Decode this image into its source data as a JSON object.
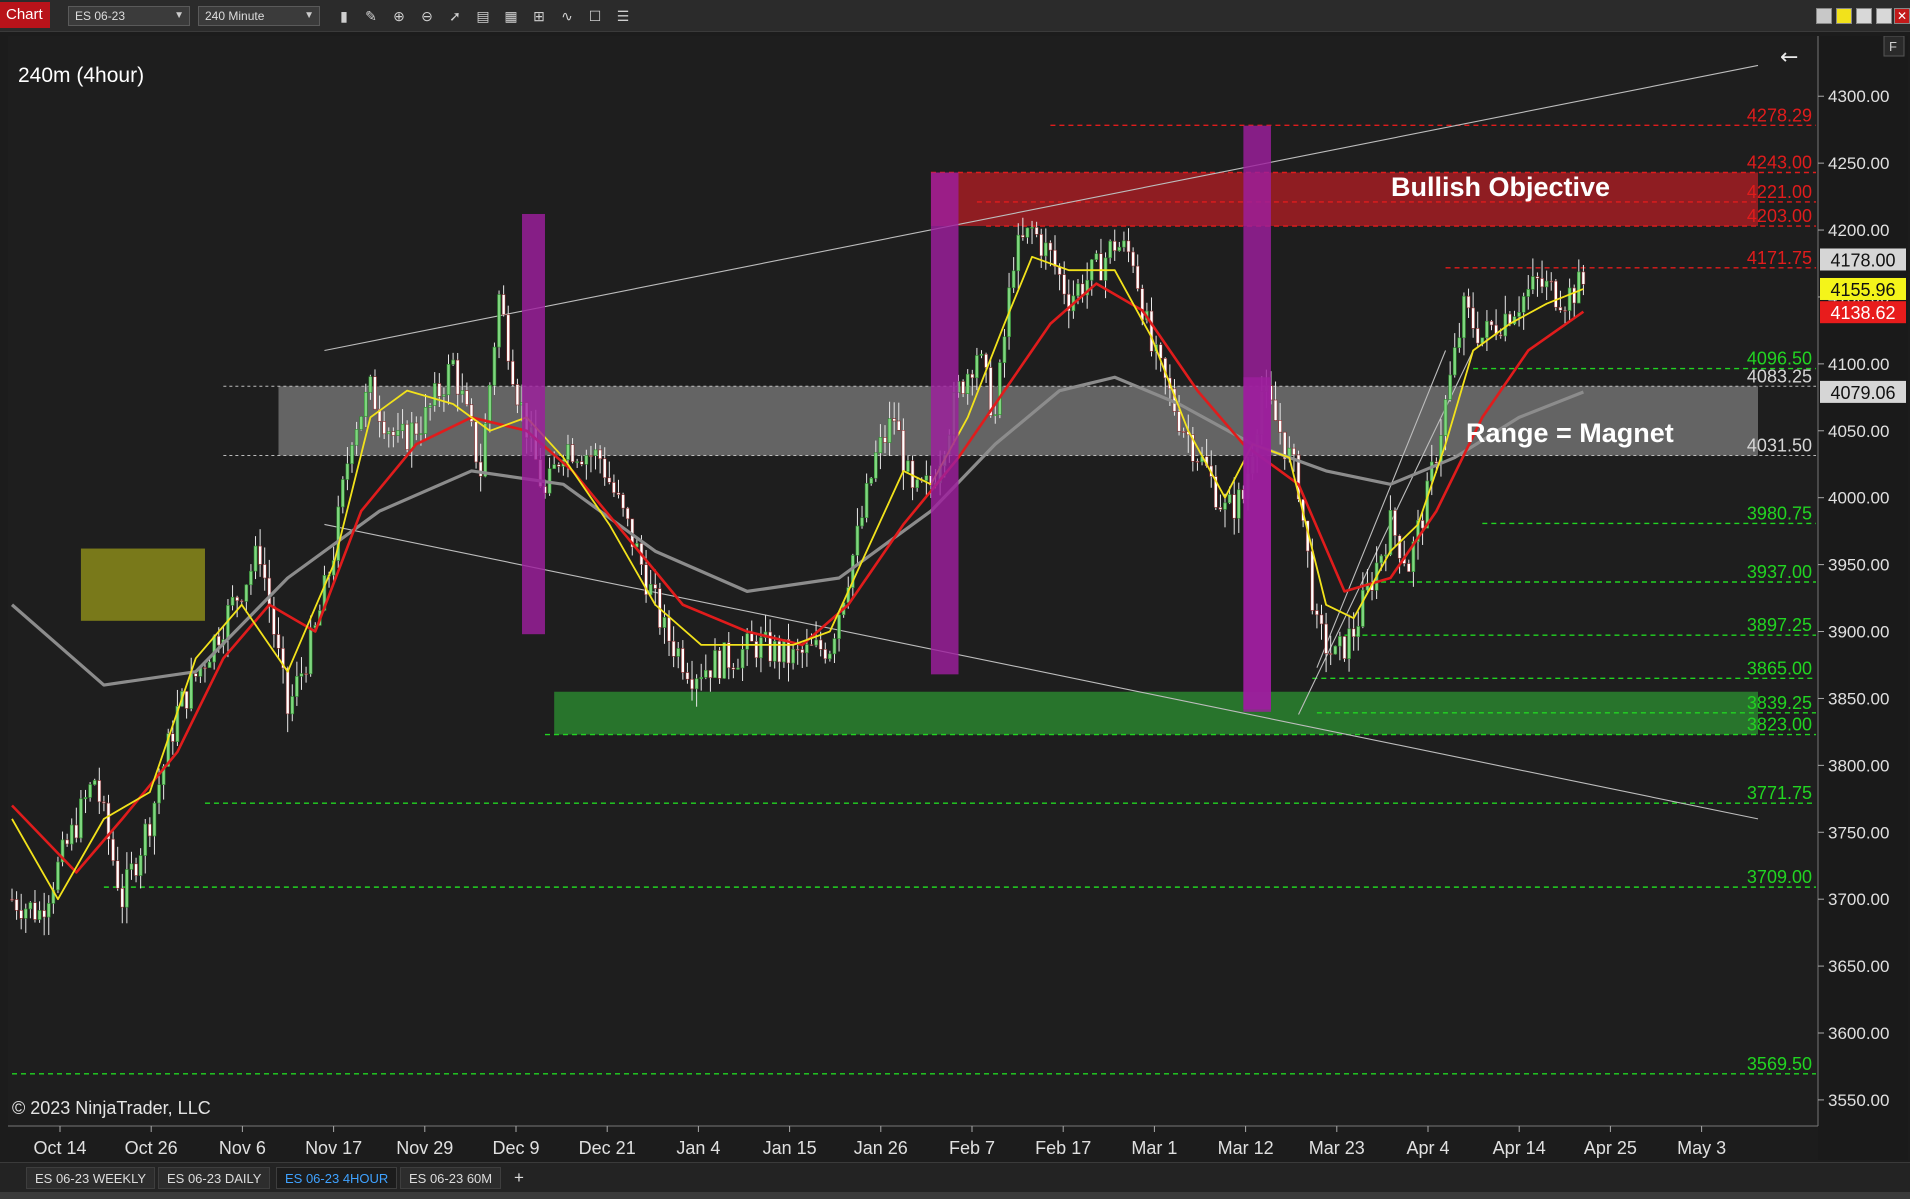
{
  "window": {
    "app_label": "Chart",
    "instrument": "ES 06-23",
    "timeframe": "240 Minute",
    "f_button": "F"
  },
  "chart": {
    "panel_label": "240m (4hour)",
    "copyright": "© 2023 NinjaTrader, LLC",
    "back_arrow": "←",
    "annotations": {
      "bullish_objective": "Bullish Objective",
      "range_magnet": "Range = Magnet"
    },
    "colors": {
      "background": "#1e1e1e",
      "fast_ma": "#f2e21b",
      "slow_ma": "#e01c1c",
      "long_ma": "#8c8c8c",
      "support_level": "#22d422",
      "resistance_level": "#e01c1c",
      "supply_zone": "#b51e24",
      "demand_zone": "#2b8a2f",
      "range_zone": "#8a8a8a",
      "highlight_bar": "#9d1f9d",
      "yellow_box": "#8a8a1a"
    }
  },
  "chart_data": {
    "type": "candlestick",
    "y_axis_ticks": [
      "4300.00",
      "4250.00",
      "4200.00",
      "4150.00",
      "4100.00",
      "4050.00",
      "4000.00",
      "3950.00",
      "3900.00",
      "3850.00",
      "3800.00",
      "3750.00",
      "3700.00",
      "3650.00",
      "3600.00",
      "3550.00"
    ],
    "ylim": [
      3532,
      4345
    ],
    "x_axis_ticks": [
      "Oct 14",
      "Oct 26",
      "Nov 6",
      "Nov 17",
      "Nov 29",
      "Dec 9",
      "Dec 21",
      "Jan 4",
      "Jan 15",
      "Jan 26",
      "Feb 7",
      "Feb 17",
      "Mar 1",
      "Mar 12",
      "Mar 23",
      "Apr 4",
      "Apr 14",
      "Apr 25",
      "May 3"
    ],
    "price_markers": [
      {
        "label": "4178.00",
        "value": 4178.0,
        "style": "gray"
      },
      {
        "label": "4155.96",
        "value": 4155.96,
        "style": "yellow"
      },
      {
        "label": "4138.62",
        "value": 4138.62,
        "style": "red"
      },
      {
        "label": "4079.06",
        "value": 4079.06,
        "style": "gray"
      }
    ],
    "resistance_levels": [
      {
        "label": "4278.29",
        "value": 4278.29
      },
      {
        "label": "4243.00",
        "value": 4243.0
      },
      {
        "label": "4221.00",
        "value": 4221.0
      },
      {
        "label": "4203.00",
        "value": 4203.0
      },
      {
        "label": "4171.75",
        "value": 4171.75
      }
    ],
    "support_levels": [
      {
        "label": "4096.50",
        "value": 4096.5
      },
      {
        "label": "3980.75",
        "value": 3980.75
      },
      {
        "label": "3937.00",
        "value": 3937.0
      },
      {
        "label": "3897.25",
        "value": 3897.25
      },
      {
        "label": "3865.00",
        "value": 3865.0
      },
      {
        "label": "3839.25",
        "value": 3839.25
      },
      {
        "label": "3823.00",
        "value": 3823.0
      },
      {
        "label": "3771.75",
        "value": 3771.75
      },
      {
        "label": "3709.00",
        "value": 3709.0
      },
      {
        "label": "3569.50",
        "value": 3569.5
      }
    ],
    "range_levels": [
      {
        "label": "4083.25",
        "value": 4083.25
      },
      {
        "label": "4031.50",
        "value": 4031.5
      }
    ],
    "close_path": [
      [
        0,
        3700
      ],
      [
        6,
        3690
      ],
      [
        12,
        3740
      ],
      [
        18,
        3790
      ],
      [
        24,
        3700
      ],
      [
        30,
        3760
      ],
      [
        36,
        3840
      ],
      [
        42,
        3880
      ],
      [
        48,
        3920
      ],
      [
        54,
        3960
      ],
      [
        60,
        3840
      ],
      [
        66,
        3900
      ],
      [
        70,
        3960
      ],
      [
        74,
        4050
      ],
      [
        78,
        4080
      ],
      [
        84,
        4040
      ],
      [
        90,
        4060
      ],
      [
        96,
        4100
      ],
      [
        102,
        4020
      ],
      [
        106,
        4150
      ],
      [
        110,
        4080
      ],
      [
        116,
        4000
      ],
      [
        120,
        4040
      ],
      [
        128,
        4030
      ],
      [
        136,
        3960
      ],
      [
        142,
        3900
      ],
      [
        148,
        3870
      ],
      [
        156,
        3880
      ],
      [
        162,
        3890
      ],
      [
        170,
        3880
      ],
      [
        178,
        3890
      ],
      [
        184,
        3970
      ],
      [
        188,
        4030
      ],
      [
        192,
        4060
      ],
      [
        196,
        4000
      ],
      [
        200,
        4010
      ],
      [
        206,
        4080
      ],
      [
        210,
        4110
      ],
      [
        214,
        4060
      ],
      [
        218,
        4180
      ],
      [
        222,
        4200
      ],
      [
        226,
        4180
      ],
      [
        230,
        4150
      ],
      [
        236,
        4170
      ],
      [
        240,
        4190
      ],
      [
        244,
        4180
      ],
      [
        248,
        4110
      ],
      [
        254,
        4060
      ],
      [
        260,
        4020
      ],
      [
        264,
        3990
      ],
      [
        268,
        4000
      ],
      [
        272,
        4080
      ],
      [
        276,
        4050
      ],
      [
        280,
        4010
      ],
      [
        284,
        3900
      ],
      [
        288,
        3880
      ],
      [
        292,
        3900
      ],
      [
        296,
        3940
      ],
      [
        300,
        3980
      ],
      [
        304,
        3950
      ],
      [
        308,
        4000
      ],
      [
        312,
        4070
      ],
      [
        316,
        4140
      ],
      [
        320,
        4120
      ],
      [
        326,
        4140
      ],
      [
        332,
        4160
      ],
      [
        338,
        4150
      ],
      [
        342,
        4160
      ]
    ],
    "fast_ma_path": [
      [
        0,
        3760
      ],
      [
        10,
        3700
      ],
      [
        20,
        3760
      ],
      [
        30,
        3780
      ],
      [
        40,
        3880
      ],
      [
        50,
        3920
      ],
      [
        60,
        3870
      ],
      [
        70,
        3950
      ],
      [
        78,
        4060
      ],
      [
        86,
        4080
      ],
      [
        96,
        4070
      ],
      [
        104,
        4050
      ],
      [
        112,
        4060
      ],
      [
        120,
        4030
      ],
      [
        130,
        3980
      ],
      [
        140,
        3920
      ],
      [
        150,
        3890
      ],
      [
        160,
        3890
      ],
      [
        170,
        3890
      ],
      [
        178,
        3900
      ],
      [
        186,
        3960
      ],
      [
        194,
        4020
      ],
      [
        200,
        4010
      ],
      [
        208,
        4060
      ],
      [
        216,
        4130
      ],
      [
        222,
        4180
      ],
      [
        230,
        4170
      ],
      [
        240,
        4170
      ],
      [
        248,
        4120
      ],
      [
        256,
        4050
      ],
      [
        264,
        4000
      ],
      [
        270,
        4040
      ],
      [
        278,
        4030
      ],
      [
        286,
        3920
      ],
      [
        292,
        3910
      ],
      [
        300,
        3960
      ],
      [
        306,
        3980
      ],
      [
        312,
        4040
      ],
      [
        318,
        4110
      ],
      [
        326,
        4130
      ],
      [
        334,
        4145
      ],
      [
        342,
        4156
      ]
    ],
    "slow_ma_path": [
      [
        0,
        3770
      ],
      [
        14,
        3720
      ],
      [
        24,
        3760
      ],
      [
        36,
        3810
      ],
      [
        46,
        3880
      ],
      [
        56,
        3920
      ],
      [
        66,
        3900
      ],
      [
        76,
        3990
      ],
      [
        88,
        4040
      ],
      [
        100,
        4060
      ],
      [
        112,
        4050
      ],
      [
        122,
        4020
      ],
      [
        134,
        3970
      ],
      [
        146,
        3920
      ],
      [
        160,
        3900
      ],
      [
        172,
        3890
      ],
      [
        182,
        3920
      ],
      [
        194,
        3980
      ],
      [
        206,
        4030
      ],
      [
        216,
        4080
      ],
      [
        226,
        4130
      ],
      [
        236,
        4160
      ],
      [
        246,
        4140
      ],
      [
        258,
        4080
      ],
      [
        268,
        4040
      ],
      [
        280,
        4010
      ],
      [
        290,
        3930
      ],
      [
        300,
        3940
      ],
      [
        310,
        3990
      ],
      [
        320,
        4060
      ],
      [
        330,
        4110
      ],
      [
        342,
        4139
      ]
    ],
    "long_ma_path": [
      [
        0,
        3920
      ],
      [
        20,
        3860
      ],
      [
        40,
        3870
      ],
      [
        60,
        3940
      ],
      [
        80,
        3990
      ],
      [
        100,
        4020
      ],
      [
        120,
        4010
      ],
      [
        140,
        3960
      ],
      [
        160,
        3930
      ],
      [
        180,
        3940
      ],
      [
        200,
        3990
      ],
      [
        214,
        4040
      ],
      [
        228,
        4080
      ],
      [
        240,
        4090
      ],
      [
        254,
        4070
      ],
      [
        270,
        4040
      ],
      [
        286,
        4020
      ],
      [
        300,
        4010
      ],
      [
        314,
        4030
      ],
      [
        328,
        4060
      ],
      [
        342,
        4079
      ]
    ],
    "trendlines": [
      {
        "from": [
          68,
          4110
        ],
        "to": [
          380,
          4323
        ]
      },
      {
        "from": [
          68,
          3980
        ],
        "to": [
          380,
          3760
        ]
      },
      {
        "from": [
          284,
          3873
        ],
        "to": [
          312,
          4110
        ]
      },
      {
        "from": [
          280,
          3838
        ],
        "to": [
          318,
          4110
        ]
      }
    ],
    "zones": [
      {
        "name": "supply",
        "x": [
          200,
          380
        ],
        "y": [
          4203,
          4243
        ]
      },
      {
        "name": "range",
        "x": [
          58,
          380
        ],
        "y": [
          4031.5,
          4083.25
        ]
      },
      {
        "name": "demand",
        "x": [
          118,
          380
        ],
        "y": [
          3823,
          3855
        ]
      },
      {
        "name": "yellow-box",
        "x": [
          15,
          42
        ],
        "y": [
          3908,
          3962
        ]
      }
    ],
    "highlight_bars": [
      {
        "x": [
          111,
          116
        ],
        "y": [
          3898,
          4212
        ]
      },
      {
        "x": [
          200,
          206
        ],
        "y": [
          3868,
          4243
        ]
      },
      {
        "x": [
          268,
          274
        ],
        "y": [
          3840,
          4278
        ]
      },
      {
        "x": [
          268,
          274
        ],
        "y": [
          3842,
          4090
        ]
      }
    ]
  },
  "tabs": [
    {
      "label": "ES 06-23 WEEKLY",
      "active": false
    },
    {
      "label": "ES 06-23 DAILY",
      "active": false
    },
    {
      "label": "ES 06-23 4HOUR",
      "active": true
    },
    {
      "label": "ES 06-23 60M",
      "active": false
    }
  ],
  "add_tab": "+"
}
